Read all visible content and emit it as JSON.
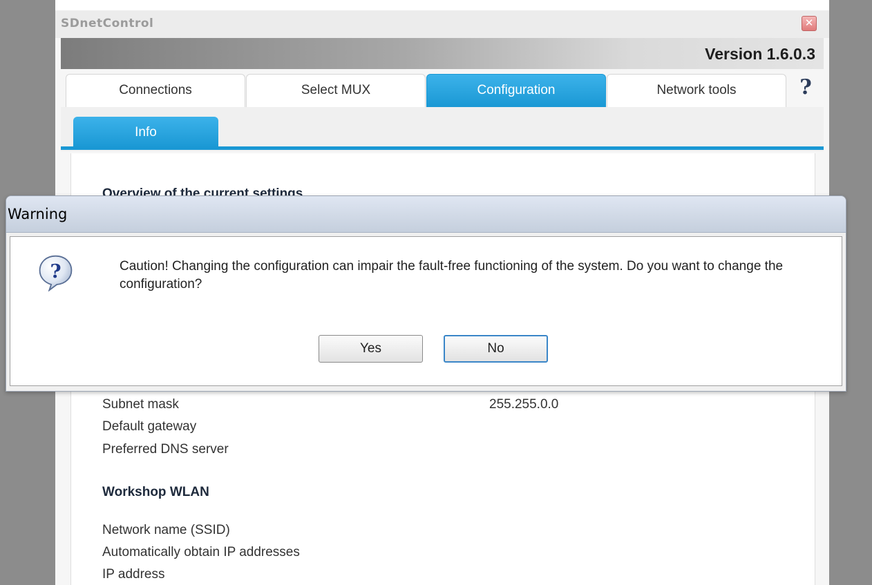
{
  "window": {
    "title": "SDnetControl",
    "close_glyph": "✕",
    "version": "Version 1.6.0.3"
  },
  "tabs": [
    {
      "label": "Connections",
      "active": false
    },
    {
      "label": "Select MUX",
      "active": false
    },
    {
      "label": "Configuration",
      "active": true
    },
    {
      "label": "Network tools",
      "active": false
    }
  ],
  "help_glyph": "?",
  "subtab": {
    "label": "Info"
  },
  "content": {
    "overview_title": "Overview of the current settings",
    "rows": [
      {
        "label": "Subnet mask",
        "value": "255.255.0.0"
      },
      {
        "label": "Default gateway",
        "value": ""
      },
      {
        "label": "Preferred DNS server",
        "value": ""
      }
    ],
    "wlan_title": "Workshop WLAN",
    "wlan_rows": [
      {
        "label": "Network name (SSID)"
      },
      {
        "label": "Automatically obtain IP addresses"
      },
      {
        "label": "IP address"
      }
    ]
  },
  "dialog": {
    "title": "Warning",
    "icon": "question-icon",
    "message": "Caution! Changing the configuration can impair the fault-free functioning of the system. Do you want to change the configuration?",
    "yes_label": "Yes",
    "no_label": "No",
    "default_button": "No"
  },
  "colors": {
    "accent": "#1a98d4",
    "desktop": "#8c8c8c",
    "dialog_border": "#3a86c8"
  }
}
